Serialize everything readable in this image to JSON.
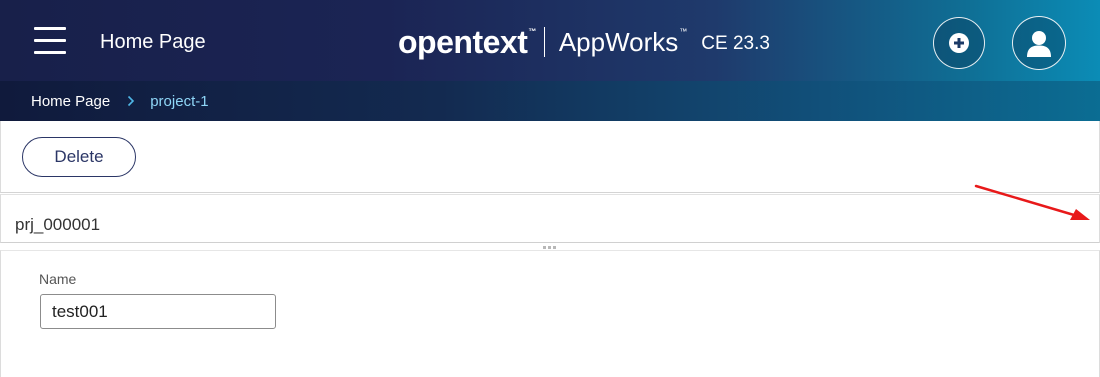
{
  "header": {
    "menu_icon": "hamburger-menu-icon",
    "title": "Home Page",
    "brand": {
      "logo_text": "opentext",
      "logo_tm": "™",
      "product": "AppWorks",
      "product_tm": "™",
      "version": "CE 23.3"
    },
    "add_icon": "plus-circle-icon",
    "user_icon": "user-icon"
  },
  "breadcrumb": {
    "home": "Home Page",
    "separator_icon": "chevron-right-icon",
    "current": "project-1"
  },
  "toolbar": {
    "delete_label": "Delete"
  },
  "record": {
    "id": "prj_000001"
  },
  "form": {
    "name_label": "Name",
    "name_value": "test001"
  },
  "colors": {
    "header_dark": "#18204a",
    "header_teal": "#0b8cb6",
    "breadcrumb_current": "#8fd6f7",
    "button_border": "#2b3666",
    "annotation_arrow": "#e8191a"
  }
}
